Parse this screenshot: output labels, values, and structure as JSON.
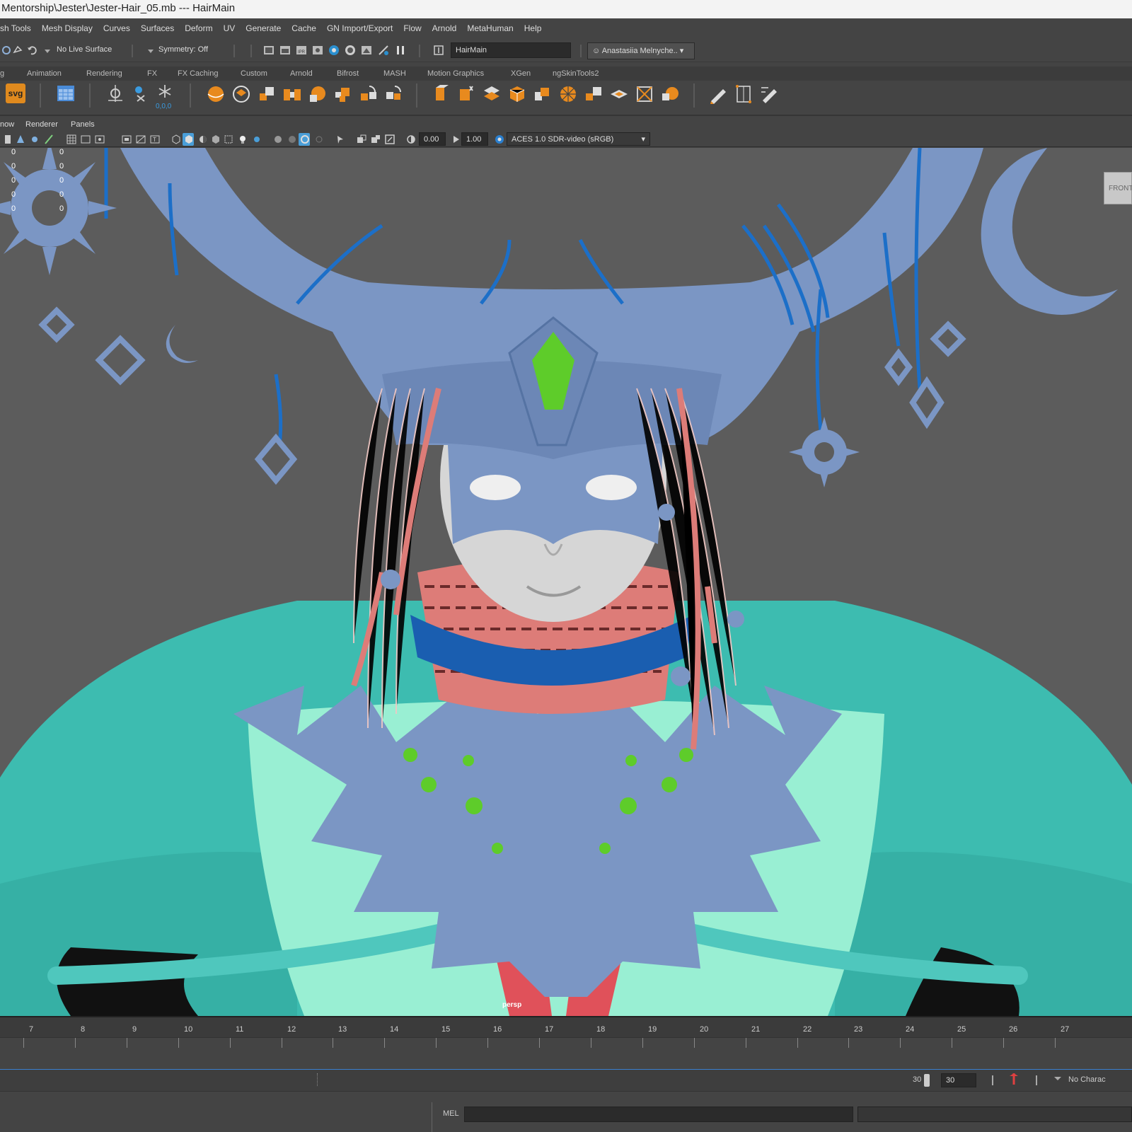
{
  "window": {
    "title": "Mentorship\\Jester\\Jester-Hair_05.mb    ---    HairMain"
  },
  "menubar": {
    "items": [
      "sh Tools",
      "Mesh Display",
      "Curves",
      "Surfaces",
      "Deform",
      "UV",
      "Generate",
      "Cache",
      "GN Import/Export",
      "Flow",
      "Arnold",
      "MetaHuman",
      "Help"
    ]
  },
  "statusline": {
    "live_surface": "No Live Surface",
    "symmetry": "Symmetry: Off",
    "camera_field": "HairMain",
    "account": "Anastasiia Melnyche.."
  },
  "shelf_tabs": [
    "g",
    "Animation",
    "Rendering",
    "FX",
    "FX Caching",
    "Custom",
    "Arnold",
    "Bifrost",
    "MASH",
    "Motion Graphics",
    "XGen",
    "ngSkinTools2"
  ],
  "shelf": {
    "svg_label": "svg",
    "snow_value": "0,0,0"
  },
  "panel_menu": [
    "now",
    "Renderer",
    "Panels"
  ],
  "panel_toolbar": {
    "exposure": "0.00",
    "gamma": "1.00",
    "color_space": "ACES 1.0 SDR-video (sRGB)"
  },
  "viewport": {
    "camera_label": "persp",
    "viewcube_label": "FRONT",
    "hud_values": [
      "0",
      "0",
      "0",
      "0",
      "0",
      "0",
      "0",
      "0",
      "0",
      "0",
      "0",
      "0"
    ]
  },
  "timeline": {
    "frames": [
      "7",
      "8",
      "9",
      "10",
      "11",
      "12",
      "13",
      "14",
      "15",
      "16",
      "17",
      "18",
      "19",
      "20",
      "21",
      "22",
      "23",
      "24",
      "25",
      "26",
      "27"
    ]
  },
  "range": {
    "end_a": "30",
    "end_b": "30",
    "character": "No Charac"
  },
  "command": {
    "language": "MEL"
  },
  "colors": {
    "mask": "#7c98c6",
    "cloak": "#3fbcb2",
    "skin": "#d4d4d4",
    "tassel": "#dd7c78",
    "gem": "#6bc43a",
    "cord": "#1c6fc8"
  }
}
